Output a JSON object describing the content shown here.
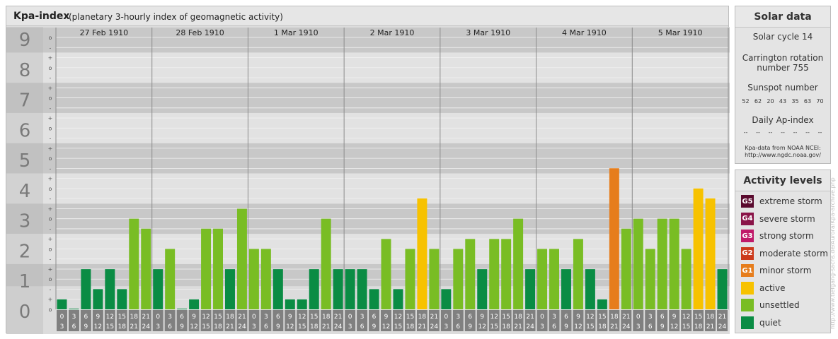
{
  "header": {
    "title": "Kpa-index",
    "subtitle": "(planetary 3-hourly index of geomagnetic activity)"
  },
  "chart_data": {
    "type": "bar",
    "title": "Kpa-index",
    "subtitle": "(planetary 3-hourly index of geomagnetic activity)",
    "ylim": [
      0,
      9
    ],
    "y_major_ticks": [
      "0",
      "1",
      "2",
      "3",
      "4",
      "5",
      "6",
      "7",
      "8",
      "9"
    ],
    "y_minor_ticks": [
      "-",
      "o",
      "+"
    ],
    "days": [
      "27 Feb 1910",
      "28 Feb 1910",
      "1 Mar 1910",
      "2 Mar 1910",
      "3 Mar 1910",
      "4 Mar 1910",
      "5 Mar 1910"
    ],
    "interval_start_labels": [
      "0",
      "3",
      "6",
      "9",
      "12",
      "15",
      "18",
      "21"
    ],
    "interval_end_labels": [
      "3",
      "6",
      "9",
      "12",
      "15",
      "18",
      "21",
      "24"
    ],
    "values": [
      0.33,
      0.0,
      1.33,
      0.67,
      1.33,
      0.67,
      3.0,
      2.67,
      1.33,
      2.0,
      0.0,
      0.33,
      2.67,
      2.67,
      1.33,
      3.33,
      2.0,
      2.0,
      1.33,
      0.33,
      0.33,
      1.33,
      3.0,
      1.33,
      1.33,
      1.33,
      0.67,
      2.33,
      0.67,
      2.0,
      3.67,
      2.0,
      0.67,
      2.0,
      2.33,
      1.33,
      2.33,
      2.33,
      3.0,
      1.33,
      2.0,
      2.0,
      1.33,
      2.33,
      1.33,
      0.33,
      4.67,
      2.67,
      3.0,
      2.0,
      3.0,
      3.0,
      2.0,
      4.0,
      3.67,
      1.33
    ],
    "levels": [
      "quiet",
      "quiet",
      "quiet",
      "quiet",
      "quiet",
      "quiet",
      "unsettled",
      "unsettled",
      "quiet",
      "unsettled",
      "quiet",
      "quiet",
      "unsettled",
      "unsettled",
      "quiet",
      "unsettled",
      "unsettled",
      "unsettled",
      "quiet",
      "quiet",
      "quiet",
      "quiet",
      "unsettled",
      "quiet",
      "quiet",
      "quiet",
      "quiet",
      "unsettled",
      "quiet",
      "unsettled",
      "active",
      "unsettled",
      "quiet",
      "unsettled",
      "unsettled",
      "quiet",
      "unsettled",
      "unsettled",
      "unsettled",
      "quiet",
      "unsettled",
      "unsettled",
      "quiet",
      "unsettled",
      "quiet",
      "quiet",
      "minor storm",
      "unsettled",
      "unsettled",
      "unsettled",
      "unsettled",
      "unsettled",
      "unsettled",
      "active",
      "active",
      "quiet"
    ],
    "colors": {
      "quiet": "#0a8c44",
      "unsettled": "#79bd24",
      "active": "#f7c200",
      "minor storm": "#e67d1c"
    },
    "grid": true,
    "legend_position": "right"
  },
  "solar_data": {
    "heading": "Solar data",
    "solar_cycle": "Solar cycle 14",
    "carrington_line1": "Carrington rotation",
    "carrington_line2": "number 755",
    "sunspot_label": "Sunspot number",
    "sunspot_values": [
      "52",
      "62",
      "20",
      "43",
      "35",
      "63",
      "70"
    ],
    "ap_label": "Daily Ap-index",
    "ap_values": [
      "--",
      "--",
      "--",
      "--",
      "--",
      "--",
      "--"
    ],
    "source_line1": "Kpa-data from NOAA NCEI:",
    "source_line2": "http://www.ngdc.noaa.gov/"
  },
  "activity_levels": {
    "heading": "Activity levels",
    "items": [
      {
        "code": "G5",
        "label": "extreme storm",
        "color": "#5a0a2e"
      },
      {
        "code": "G4",
        "label": "severe storm",
        "color": "#8a1448"
      },
      {
        "code": "G3",
        "label": "strong storm",
        "color": "#c01a6a"
      },
      {
        "code": "G2",
        "label": "moderate storm",
        "color": "#cc3a1c"
      },
      {
        "code": "G1",
        "label": "minor storm",
        "color": "#e67d1c"
      },
      {
        "code": "",
        "label": "active",
        "color": "#f7c200"
      },
      {
        "code": "",
        "label": "unsettled",
        "color": "#79bd24"
      },
      {
        "code": "",
        "label": "quiet",
        "color": "#0a8c44"
      }
    ]
  },
  "watermark": "http://www.tiefgang-sachs.de/Aurora/Kpa-archive.php"
}
